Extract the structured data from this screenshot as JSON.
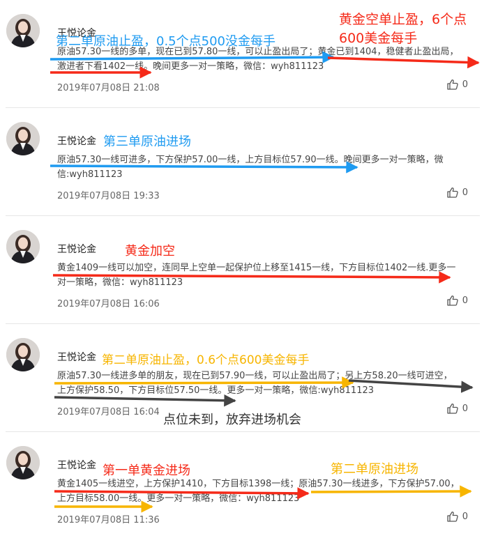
{
  "posts": [
    {
      "author": "王悦论金",
      "lines": [
        "原油57.30一线的多单，现在已到57.80一线，可以止盈出局了；黄金已到1404，稳健者止盈出局，",
        "激进者下看1402一线。晚间更多一对一策略，微信：wyh811123"
      ],
      "timestamp": "2019年07月08日 21:08",
      "likes": "0"
    },
    {
      "author": "王悦论金",
      "lines": [
        "原油57.30一线可进多，下方保护57.00一线，上方目标位57.90一线。晚间更多一对一策略，微",
        "信:wyh811123"
      ],
      "timestamp": "2019年07月08日 19:33",
      "likes": "0"
    },
    {
      "author": "王悦论金",
      "lines": [
        "黄金1409一线可以加空，连同早上空单一起保护位上移至1415一线，下方目标位1402一线.更多一",
        "对一策略，微信：wyh811123"
      ],
      "timestamp": "2019年07月08日 16:06",
      "likes": "0"
    },
    {
      "author": "王悦论金",
      "lines": [
        "原油57.30一线进多单的朋友，现在已到57.90一线，可以止盈出局了；另上方58.20一线可进空，",
        "上方保护58.50，下方目标位57.50一线。更多一对一策略，微信:wyh811123"
      ],
      "timestamp": "2019年07月08日 16:04",
      "likes": "0"
    },
    {
      "author": "王悦论金",
      "lines": [
        "黄金1405一线进空，上方保护1410，下方目标1398一线；原油57.30一线进多，下方保护57.00，",
        "上方目标58.00一线。更多一对一策略，微信：wyh811123"
      ],
      "timestamp": "2019年07月08日 11:36",
      "likes": "0"
    }
  ],
  "annotations": {
    "p1_blue": "第二单原油止盈，0.5个点500没金每手",
    "p1_red_line1": "黄金空单止盈，6个点",
    "p1_red_line2": "600美金每手",
    "p2_blue": "第三单原油进场",
    "p3_red": "黄金加空",
    "p4_orange": "第二单原油止盈，0.6个点600美金每手",
    "p4_dark": "点位未到，放弃进场机会",
    "p5_red": "第一单黄金进场",
    "p5_orange": "第二单原油进场"
  },
  "icons": {
    "like": "thumbs-up-icon",
    "avatar": "user-avatar-photo"
  },
  "colors": {
    "red": "#f52a19",
    "blue": "#1f9bf1",
    "orange": "#f7b500",
    "dark": "#333333"
  }
}
